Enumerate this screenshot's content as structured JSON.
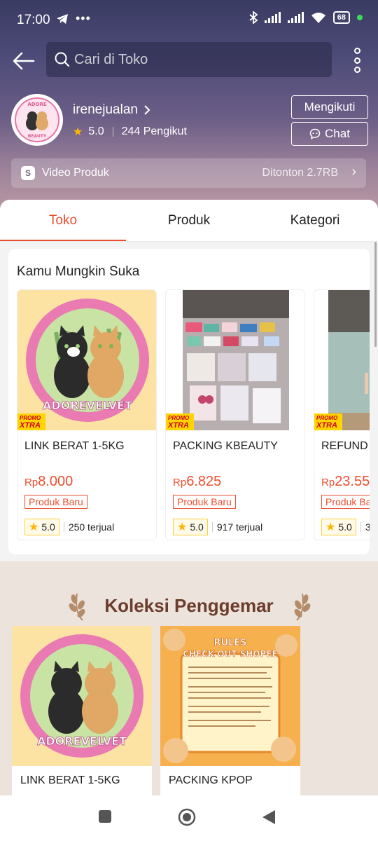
{
  "status": {
    "time": "17:00",
    "battery": "68"
  },
  "search": {
    "placeholder": "Cari di Toko"
  },
  "shop": {
    "name": "irenejualan",
    "rating": "5.0",
    "followers": "244 Pengikut",
    "follow_label": "Mengikuti",
    "chat_label": "Chat",
    "avatar_text_top": "ADORE",
    "avatar_text_bottom": "BEAUTY"
  },
  "video": {
    "label": "Video Produk",
    "views": "Ditonton 2.7RB"
  },
  "tabs": [
    {
      "label": "Toko",
      "active": true
    },
    {
      "label": "Produk",
      "active": false
    },
    {
      "label": "Kategori",
      "active": false
    }
  ],
  "suka": {
    "title": "Kamu Mungkin Suka",
    "promo_top": "PROMO",
    "promo_bottom": "XTRA",
    "products": [
      {
        "name": "LINK BERAT 1-5KG",
        "currency": "Rp",
        "price": "8.000",
        "badge": "Produk Baru",
        "rating": "5.0",
        "sold": "250 terjual",
        "image_text": "ADOREVELVET"
      },
      {
        "name": "PACKING KBEAUTY",
        "currency": "Rp",
        "price": "6.825",
        "badge": "Produk Baru",
        "rating": "5.0",
        "sold": "917 terjual"
      },
      {
        "name": "REFUND",
        "currency": "Rp",
        "price": "23.55",
        "badge": "Produk Ba",
        "rating": "5.0",
        "sold": "3"
      }
    ]
  },
  "koleksi": {
    "title": "Koleksi Penggemar",
    "products": [
      {
        "name": "LINK BERAT 1-5KG",
        "image_text": "ADOREVELVET"
      },
      {
        "name": "PACKING KPOP",
        "image_title_1": "RULES",
        "image_title_2": "CHECK-OUT SHOPEE"
      }
    ]
  },
  "colors": {
    "accent": "#ee4d2d",
    "koleksi_title": "#6b3d2a",
    "koleksi_bg": "#ece3dd"
  }
}
